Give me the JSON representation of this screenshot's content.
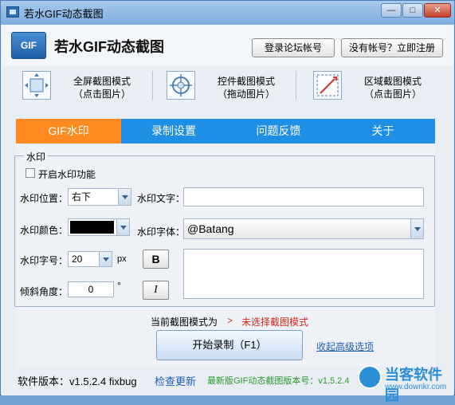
{
  "window": {
    "title": "若水GIF动态截图",
    "controls": {
      "min": "—",
      "max": "□",
      "close": "✕"
    }
  },
  "header": {
    "logo_text": "GIF",
    "app_title": "若水GIF动态截图",
    "login_button": "登录论坛帐号",
    "register_button": "没有帐号？立即注册"
  },
  "modes": [
    {
      "line1": "全屏截图模式",
      "line2": "（点击图片）",
      "icon": "fullscreen-icon"
    },
    {
      "line1": "控件截图模式",
      "line2": "（拖动图片）",
      "icon": "crosshair-icon"
    },
    {
      "line1": "区域截图模式",
      "line2": "（点击图片）",
      "icon": "region-icon"
    }
  ],
  "tabs": [
    {
      "label": "GIF水印",
      "active": true
    },
    {
      "label": "录制设置",
      "active": false
    },
    {
      "label": "问题反馈",
      "active": false
    },
    {
      "label": "关于",
      "active": false
    }
  ],
  "watermark": {
    "group_title": "水印",
    "enable_label": "开启水印功能",
    "enable_checked": false,
    "position_label": "水印位置：",
    "position_value": "右下",
    "text_label": "水印文字：",
    "text_value": "",
    "color_label": "水印颜色：",
    "color_value": "#000000",
    "font_label": "水印字体：",
    "font_value": "@Batang",
    "size_label": "水印字号：",
    "size_value": "20",
    "size_unit": "px",
    "bold_button": "B",
    "angle_label": "倾斜角度：",
    "angle_value": "0",
    "angle_unit": "°",
    "italic_button": "I",
    "preview_text": ""
  },
  "status": {
    "current_mode_label": "当前截图模式为",
    "arrow": ">",
    "current_mode_value": "未选择截图模式"
  },
  "actions": {
    "start_button": "开始录制（F1）",
    "advanced_link": "收起高级选项"
  },
  "footer": {
    "version_label": "软件版本：v1.5.2.4 fixbug",
    "check_update": "检查更新",
    "latest_version": "最新版GIF动态截图版本号：v1.5.2.4"
  },
  "watermark_logo": {
    "brand": "当客软件园",
    "url": "www.downkr.com"
  }
}
